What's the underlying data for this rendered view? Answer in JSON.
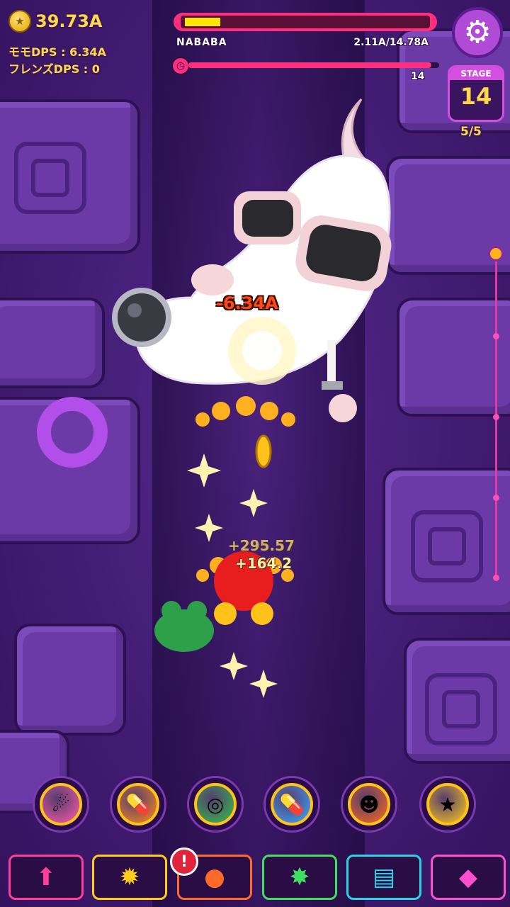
{
  "hud": {
    "coin_value": "39.73A",
    "momo_dps": "モモDPS : 6.34A",
    "friends_dps": "フレンズDPS : 0",
    "coin_icon": "coin-icon"
  },
  "boss": {
    "name": "NABABA",
    "hp_text": "2.11A/14.78A",
    "hp_fraction": 0.143,
    "timer_value": "14",
    "timer_fraction": 0.97
  },
  "stage": {
    "label": "STAGE",
    "number": "14",
    "progress": "5/5"
  },
  "combat": {
    "damage_text": "-6.34A",
    "heal_text_1": "+295.57",
    "heal_text_2": "+164.2"
  },
  "skills": [
    {
      "icon": "rainbow-meteor-icon",
      "glyph": "☄",
      "color": "#ff5aa8"
    },
    {
      "icon": "fire-capsule-icon",
      "glyph": "💊",
      "color": "#ff8a1a"
    },
    {
      "icon": "target-scope-icon",
      "glyph": "◎",
      "color": "#33c24a"
    },
    {
      "icon": "blue-capsule-icon",
      "glyph": "💊",
      "color": "#3aa7ff"
    },
    {
      "icon": "pumpkin-ghost-icon",
      "glyph": "☻",
      "color": "#ff6a1a"
    },
    {
      "icon": "gold-coin-icon",
      "glyph": "★",
      "color": "#ffcc1a"
    }
  ],
  "nav": [
    {
      "icon": "upgrade-cannon-icon",
      "glyph": "⬆",
      "color": "#ff3d9a"
    },
    {
      "icon": "sun-burst-icon",
      "glyph": "✹",
      "color": "#ffcc1a"
    },
    {
      "icon": "bomb-character-icon",
      "glyph": "●",
      "color": "#ff6a2a"
    },
    {
      "icon": "green-splash-icon",
      "glyph": "✸",
      "color": "#3fe060"
    },
    {
      "icon": "scroll-icon",
      "glyph": "▤",
      "color": "#27d4e8"
    },
    {
      "icon": "gem-shop-icon",
      "glyph": "◆",
      "color": "#ff4fd0"
    }
  ],
  "alert": "!"
}
